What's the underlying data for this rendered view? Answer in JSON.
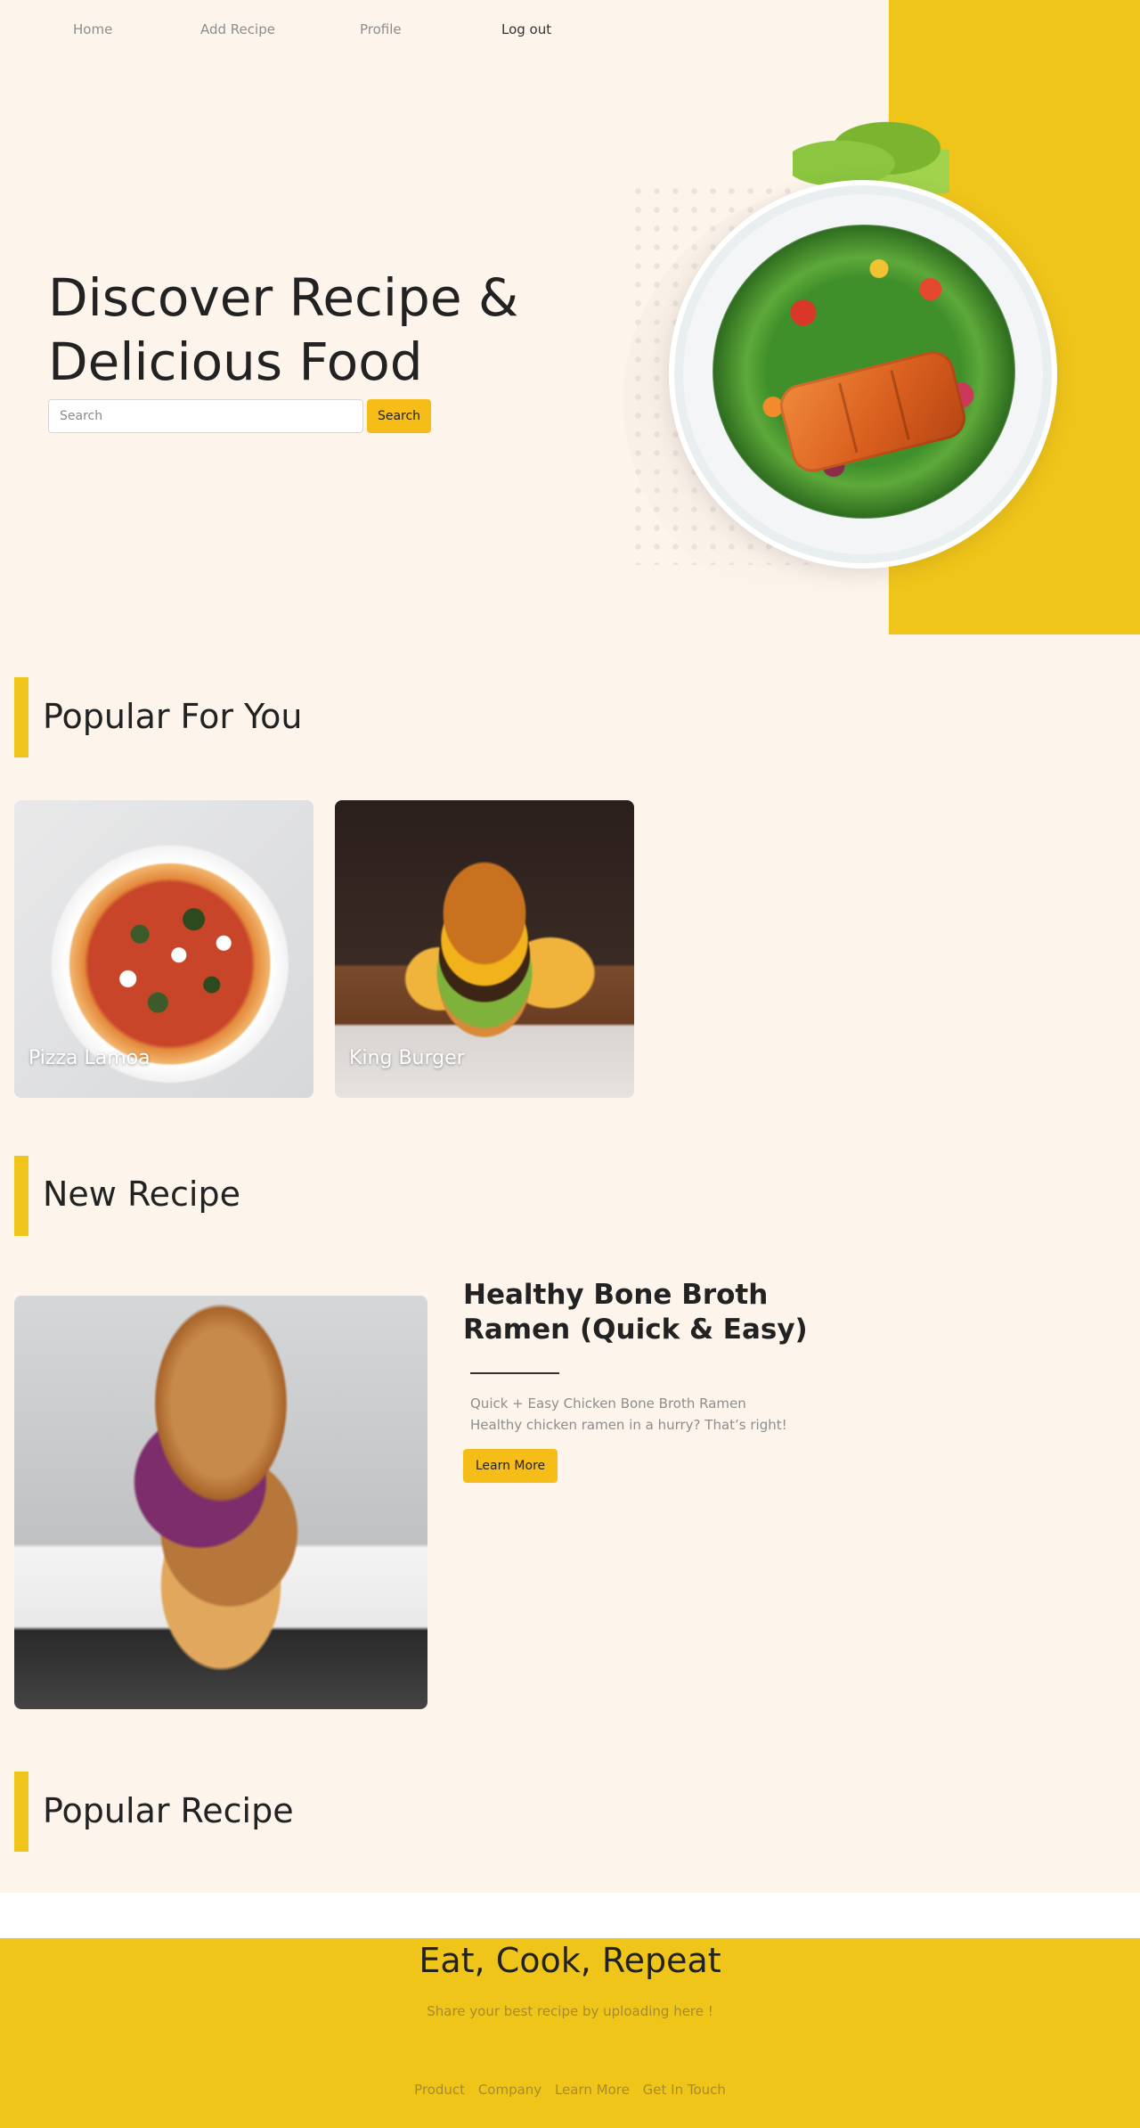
{
  "nav": {
    "items": [
      {
        "label": "Home"
      },
      {
        "label": "Add Recipe"
      },
      {
        "label": "Profile"
      },
      {
        "label": "Log out"
      }
    ]
  },
  "hero": {
    "title": "Discover Recipe & Delicious Food",
    "search_placeholder": "Search",
    "search_button": "Search",
    "image": "salad-with-salmon-plate"
  },
  "popular_for_you": {
    "heading": "Popular For You",
    "cards": [
      {
        "label": "Pizza Lamoa",
        "image": "spinach-pizza"
      },
      {
        "label": "King Burger",
        "image": "burger-with-fries"
      }
    ]
  },
  "new_recipe": {
    "heading": "New Recipe",
    "image": "burger-with-red-cabbage",
    "title": "Healthy Bone Broth Ramen (Quick & Easy)",
    "desc_line1": "Quick + Easy Chicken Bone Broth Ramen",
    "desc_line2": "Healthy chicken ramen in a hurry? That’s right!",
    "button": "Learn More"
  },
  "popular_recipe": {
    "heading": "Popular Recipe"
  },
  "footer": {
    "title": "Eat, Cook, Repeat",
    "subtitle": "Share your best recipe by uploading here !",
    "links": [
      {
        "label": "Product"
      },
      {
        "label": "Company"
      },
      {
        "label": "Learn More"
      },
      {
        "label": "Get In Touch"
      }
    ]
  },
  "colors": {
    "page_bg": "#fdf4ec",
    "accent_yellow": "#f0c51a",
    "button_yellow": "#f6bd18",
    "text_dark": "#222222",
    "text_muted": "#8d8d8d"
  }
}
